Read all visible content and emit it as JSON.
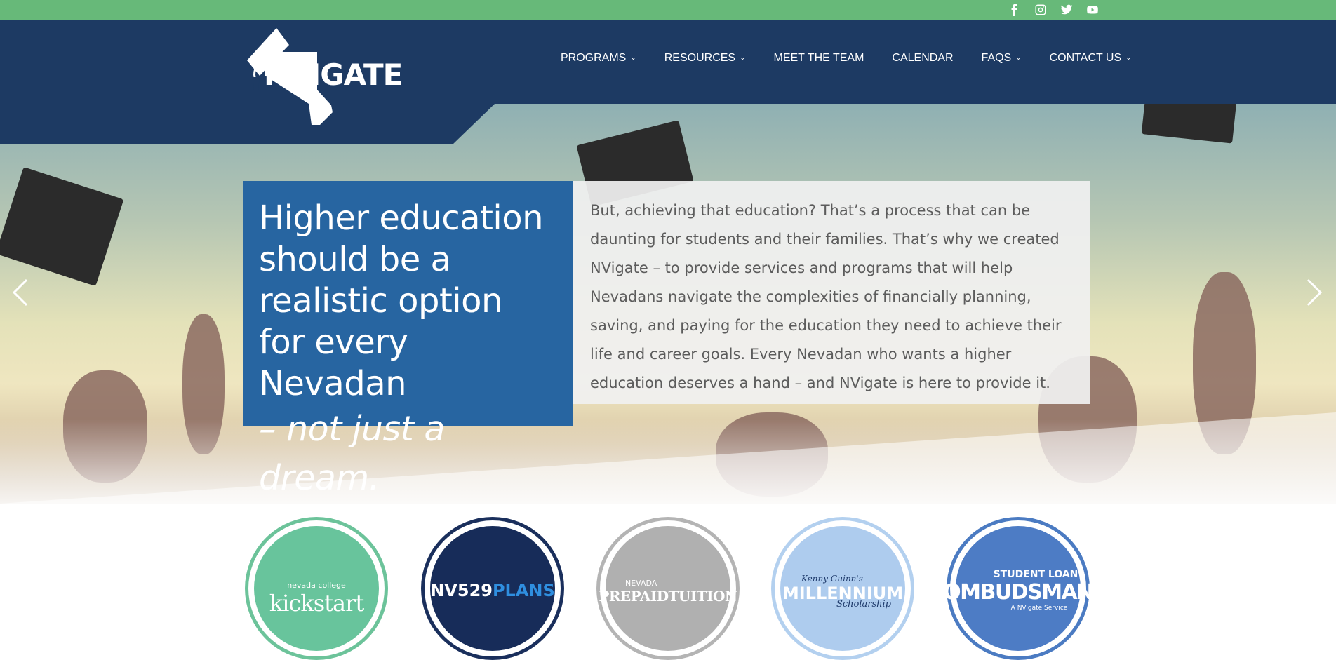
{
  "social": {
    "icons": [
      "facebook-icon",
      "instagram-icon",
      "twitter-icon",
      "youtube-icon"
    ]
  },
  "brand": {
    "logo_text": "NVIGATE"
  },
  "nav": {
    "items": [
      {
        "label": "PROGRAMS",
        "has_dropdown": true
      },
      {
        "label": "RESOURCES",
        "has_dropdown": true
      },
      {
        "label": "MEET THE TEAM",
        "has_dropdown": false
      },
      {
        "label": "CALENDAR",
        "has_dropdown": false
      },
      {
        "label": "FAQS",
        "has_dropdown": true
      },
      {
        "label": "CONTACT US",
        "has_dropdown": true
      }
    ],
    "chevron": "⌄"
  },
  "hero": {
    "headline_lines": [
      "Higher education",
      "should be a",
      "realistic option",
      "for every Nevadan"
    ],
    "headline_emphasis": "– not just a dream.",
    "body": "But, achieving that education? That’s a process that can be daunting for students and their families. That’s why we created NVigate – to provide services and programs that will help Nevadans navigate the complexities of financially planning, saving, and paying for the education they need to achieve their life and career goals. Every Nevadan who wants a higher education deserves a hand – and NVigate is here to provide it."
  },
  "programs": {
    "kickstart": {
      "small": "nevada college",
      "big": "kickstart"
    },
    "nv529": {
      "main": "NV529",
      "accent": "PLANS"
    },
    "prepaid": {
      "small": "NEVADA",
      "big": "PREPAIDTUITION"
    },
    "millennium": {
      "small": "Kenny Guinn's",
      "big": "MILLENNIUM",
      "script": "Scholarship"
    },
    "ombudsman": {
      "top": "STUDENT LOAN",
      "big": "OMBUDSMAN",
      "sub": "A NVigate Service"
    }
  },
  "colors": {
    "topbar": "#67b979",
    "header": "#1d3a63",
    "hero_box": "#2765a1"
  }
}
